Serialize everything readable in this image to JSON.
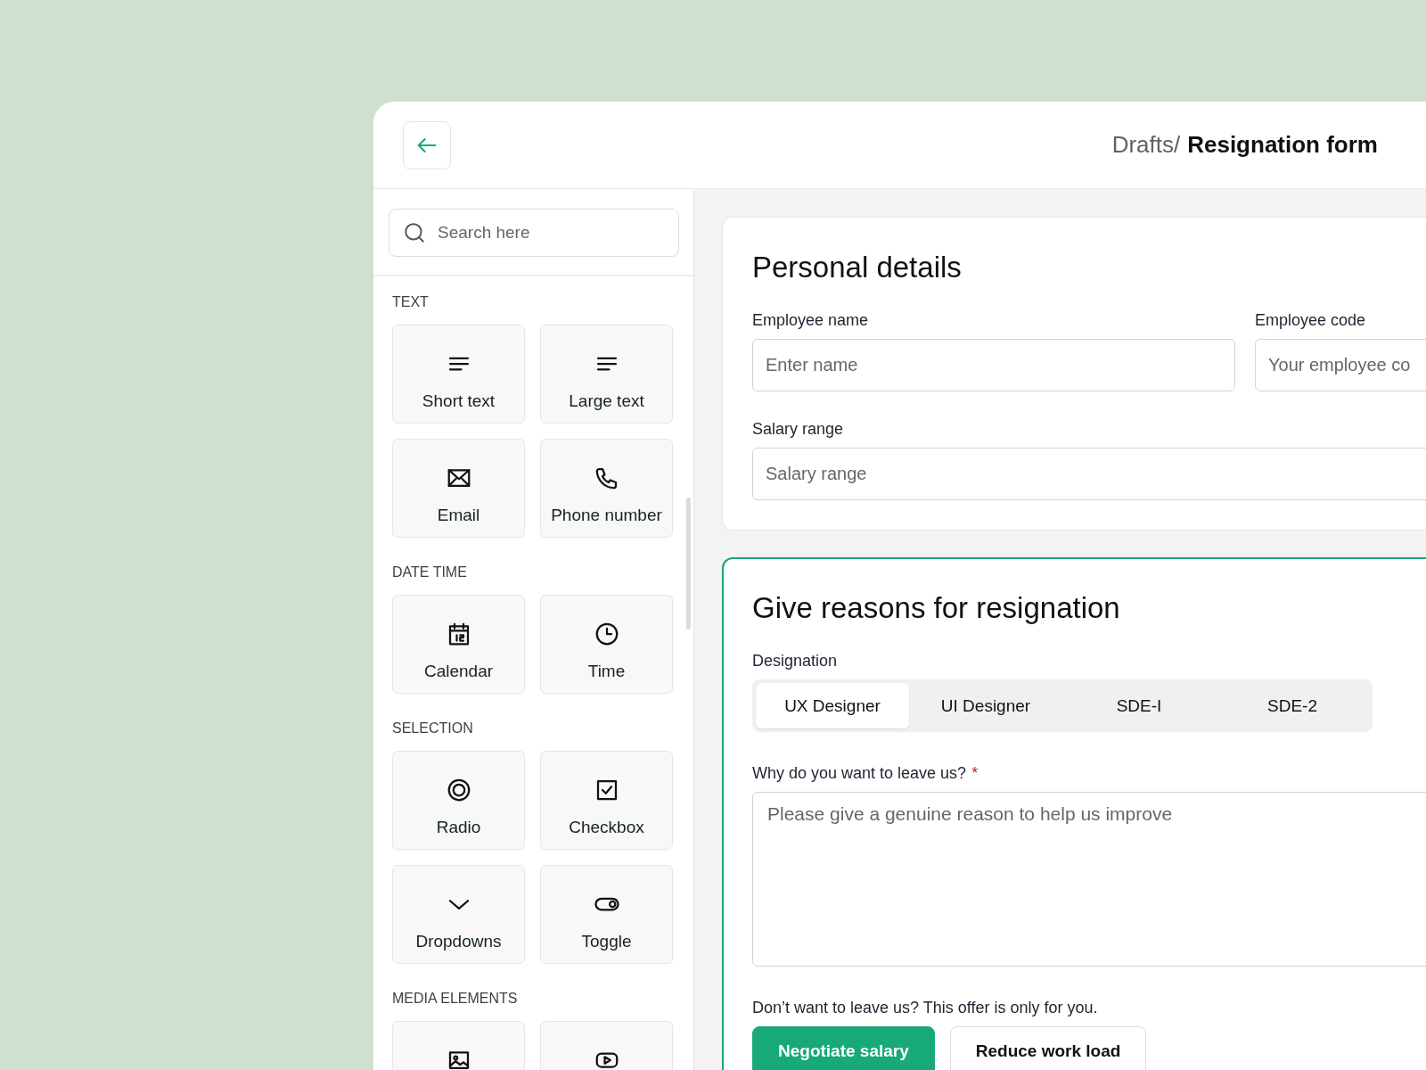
{
  "header": {
    "breadcrumb_parent": "Drafts/",
    "breadcrumb_current": "Resignation form"
  },
  "sidebar": {
    "search": {
      "placeholder": "Search here"
    },
    "sections": [
      {
        "title": "TEXT",
        "items": [
          {
            "label": "Short text",
            "kind": "lines"
          },
          {
            "label": "Large text",
            "kind": "lines"
          },
          {
            "label": "Email",
            "kind": "mail"
          },
          {
            "label": "Phone number",
            "kind": "phone"
          }
        ]
      },
      {
        "title": "DATE TIME",
        "items": [
          {
            "label": "Calendar",
            "kind": "calendar"
          },
          {
            "label": "Time",
            "kind": "clock"
          }
        ]
      },
      {
        "title": "SELECTION",
        "items": [
          {
            "label": "Radio",
            "kind": "radio"
          },
          {
            "label": "Checkbox",
            "kind": "checkbox"
          },
          {
            "label": "Dropdowns",
            "kind": "chevron"
          },
          {
            "label": "Toggle",
            "kind": "toggle"
          }
        ]
      },
      {
        "title": "MEDIA ELEMENTS",
        "items": [
          {
            "kind": "image"
          },
          {
            "kind": "video"
          }
        ]
      }
    ]
  },
  "personal_details": {
    "title": "Personal details",
    "fields": [
      {
        "label": "Employee name",
        "placeholder": "Enter name"
      },
      {
        "label": "Employee code",
        "placeholder": "Your employee co"
      },
      {
        "label": "Salary range",
        "placeholder": "Salary range"
      }
    ]
  },
  "reasons": {
    "title": "Give reasons for resignation",
    "designation_label": "Designation",
    "designations": [
      {
        "label": "UX Designer",
        "selected": true
      },
      {
        "label": "UI Designer",
        "selected": false
      },
      {
        "label": "SDE-I",
        "selected": false
      },
      {
        "label": "SDE-2",
        "selected": false
      }
    ],
    "question": {
      "label": "Why do you want to leave us?",
      "required_mark": "*",
      "placeholder": "Please give a genuine reason to help us improve"
    },
    "offer_text": "Don’t want to leave us? This offer is only for you.",
    "buttons": [
      {
        "label": "Negotiate salary",
        "kind": "primary"
      },
      {
        "label": "Reduce work load",
        "kind": "secondary"
      }
    ]
  }
}
